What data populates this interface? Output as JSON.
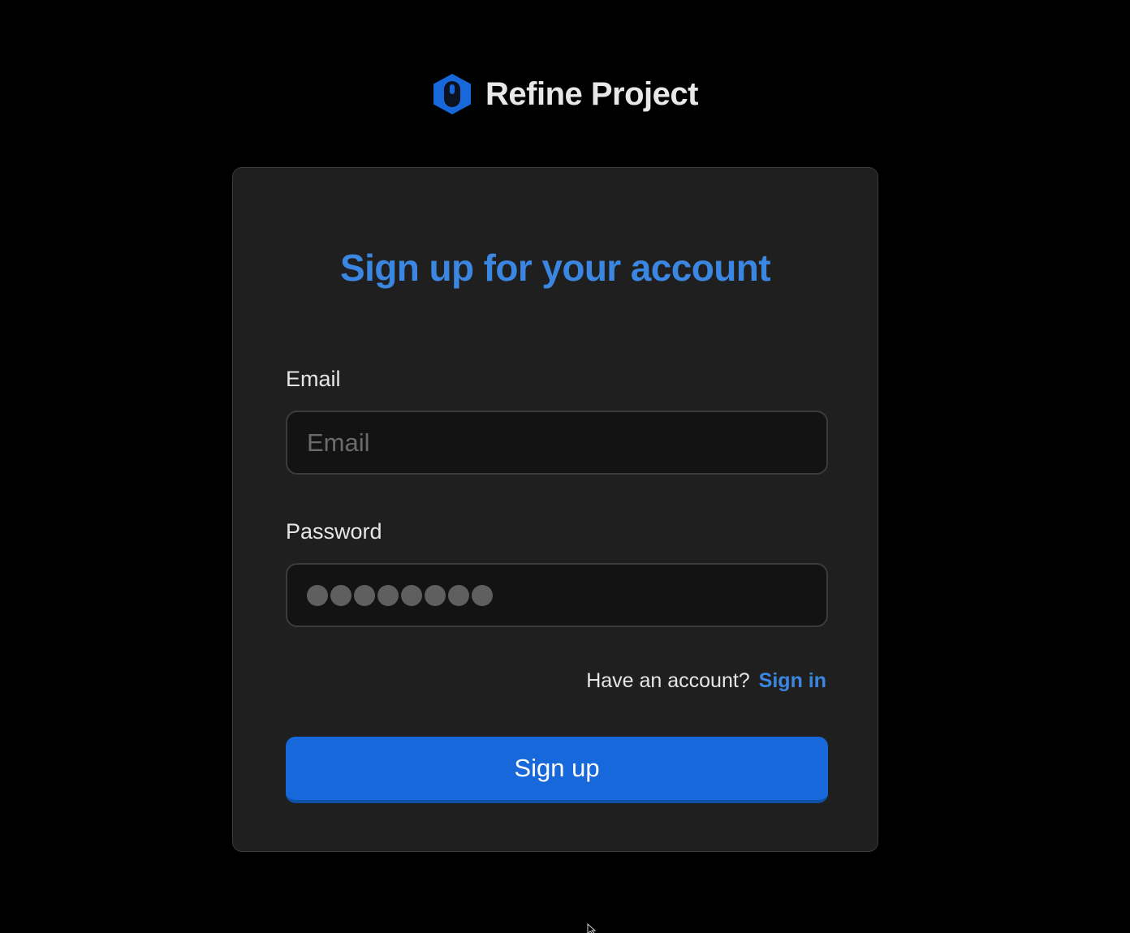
{
  "brand": {
    "name": "Refine Project",
    "logo_icon": "refine-hexagon-logo-icon",
    "logo_color": "#1769db"
  },
  "form": {
    "title": "Sign up for your account",
    "email": {
      "label": "Email",
      "placeholder": "Email",
      "value": ""
    },
    "password": {
      "label": "Password",
      "masked_value_length": 8
    },
    "account_prompt": "Have an account?",
    "signin_link": "Sign in",
    "submit_label": "Sign up"
  },
  "colors": {
    "background": "#000000",
    "card": "#1f1f1f",
    "accent": "#3b86e0",
    "button": "#1769db"
  }
}
